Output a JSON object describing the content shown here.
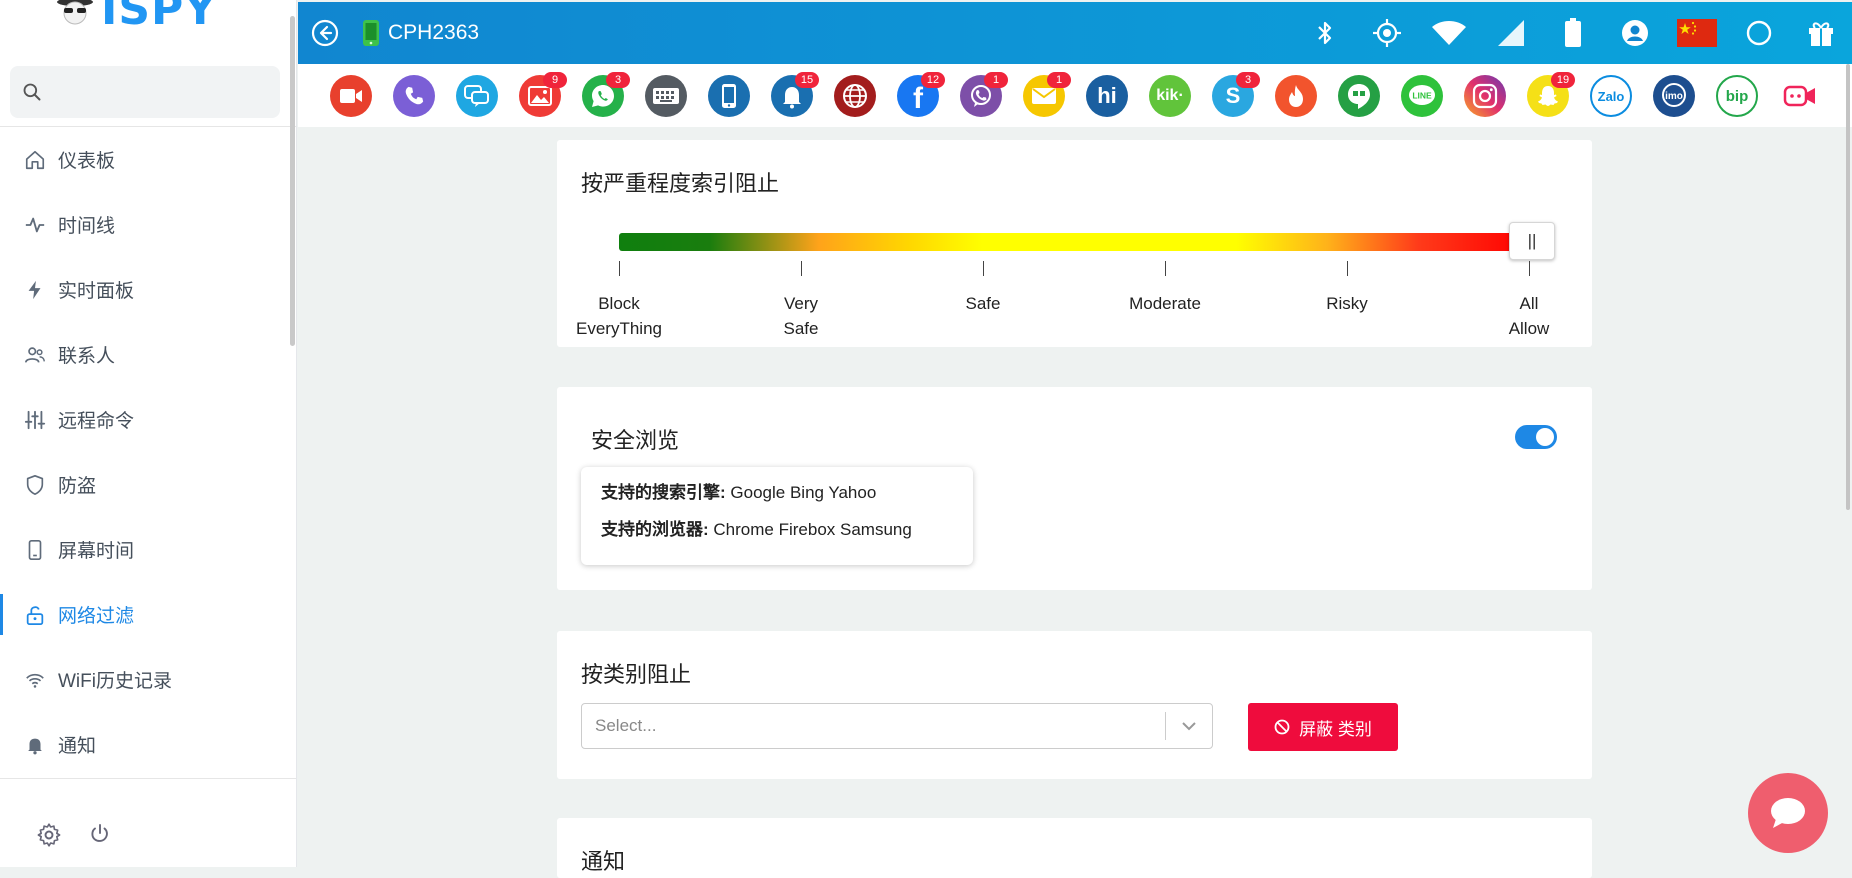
{
  "app": {
    "brand_text": "ISPY"
  },
  "sidebar": {
    "search_placeholder": "",
    "items": [
      {
        "label": "仪表板",
        "icon": "home-icon"
      },
      {
        "label": "时间线",
        "icon": "activity-icon"
      },
      {
        "label": "实时面板",
        "icon": "bolt-icon"
      },
      {
        "label": "联系人",
        "icon": "contacts-icon"
      },
      {
        "label": "远程命令",
        "icon": "sliders-icon"
      },
      {
        "label": "防盗",
        "icon": "shield-icon"
      },
      {
        "label": "屏幕时间",
        "icon": "phone-icon"
      },
      {
        "label": "网络过滤",
        "icon": "unlock-icon",
        "active": true
      },
      {
        "label": "WiFi历史记录",
        "icon": "wifi-icon"
      },
      {
        "label": "通知",
        "icon": "bell-icon"
      }
    ]
  },
  "topbar": {
    "device_name": "CPH2363",
    "status_icons": [
      "bluetooth-icon",
      "gps-icon",
      "wifi-icon",
      "signal-icon",
      "battery-icon",
      "account-icon",
      "china-flag-icon",
      "circle-icon",
      "gift-icon"
    ]
  },
  "apps": [
    {
      "name": "video-call",
      "color": "#e8402d",
      "badge": ""
    },
    {
      "name": "phone-call",
      "color": "#7b5fd6",
      "badge": ""
    },
    {
      "name": "sms",
      "color": "#1fa7e2",
      "badge": ""
    },
    {
      "name": "gallery",
      "color": "#ef3b36",
      "badge": "9"
    },
    {
      "name": "whatsapp",
      "color": "#25b14a",
      "badge": "3"
    },
    {
      "name": "keylogger",
      "color": "#545b62",
      "badge": ""
    },
    {
      "name": "device",
      "color": "#1a6fb0",
      "badge": ""
    },
    {
      "name": "notifications",
      "color": "#1a6fb0",
      "badge": "15"
    },
    {
      "name": "browser",
      "color": "#a31d1d",
      "badge": ""
    },
    {
      "name": "facebook",
      "color": "#1877f2",
      "badge": "12"
    },
    {
      "name": "viber",
      "color": "#7d4fa8",
      "badge": "1"
    },
    {
      "name": "email",
      "color": "#f6c700",
      "badge": "1"
    },
    {
      "name": "hike",
      "color": "#1a5fa0",
      "badge": ""
    },
    {
      "name": "kik",
      "color": "#61c43b",
      "badge": ""
    },
    {
      "name": "skype",
      "color": "#2aa7e0",
      "badge": "3"
    },
    {
      "name": "tinder",
      "color": "#f2542d",
      "badge": ""
    },
    {
      "name": "hangouts",
      "color": "#25a044",
      "badge": ""
    },
    {
      "name": "line",
      "color": "#2ec23b",
      "badge": ""
    },
    {
      "name": "instagram",
      "color": "#d6249f",
      "badge": ""
    },
    {
      "name": "snapchat",
      "color": "#f5e017",
      "badge": "19"
    },
    {
      "name": "zalo",
      "color": "#0b8ce0",
      "badge": ""
    },
    {
      "name": "imo",
      "color": "#1d4e8f",
      "badge": ""
    },
    {
      "name": "bip",
      "color": "#23a74b",
      "badge": ""
    },
    {
      "name": "video-chat",
      "color": "#f0245a",
      "badge": ""
    }
  ],
  "severity": {
    "title": "按严重程度索引阻止",
    "knob_label": "||",
    "levels": [
      "Block\nEveryThing",
      "Very\nSafe",
      "Safe",
      "Moderate",
      "Risky",
      "All\nAllow"
    ],
    "selected": "All\nAllow"
  },
  "safe_browsing": {
    "title": "安全浏览",
    "enabled": true,
    "engines_label": "支持的搜索引擎:",
    "engines_value": "Google Bing Yahoo",
    "browsers_label": "支持的浏览器:",
    "browsers_value": "Chrome Firebox Samsung"
  },
  "category_block": {
    "title": "按类别阻止",
    "select_placeholder": "Select...",
    "button_label": "屏蔽 类别"
  },
  "notify_card": {
    "title": "通知"
  }
}
